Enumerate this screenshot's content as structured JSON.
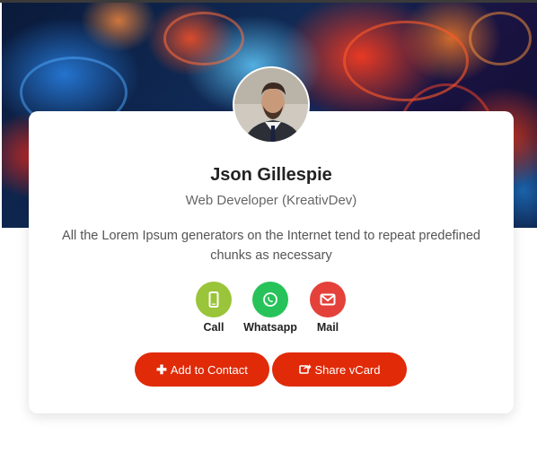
{
  "profile": {
    "name": "Json Gillespie",
    "title": "Web Developer (KreativDev)",
    "bio": "All the Lorem Ipsum generators on the Internet tend to repeat predefined chunks as necessary"
  },
  "actions": [
    {
      "label": "Call",
      "icon": "phone-icon",
      "color": "#9ac43a"
    },
    {
      "label": "Whatsapp",
      "icon": "whatsapp-icon",
      "color": "#27c35a"
    },
    {
      "label": "Mail",
      "icon": "mail-icon",
      "color": "#e4413b"
    }
  ],
  "buttons": {
    "add_contact": {
      "label": "Add to Contact",
      "icon": "plus-icon"
    },
    "share_vcard": {
      "label": "Share vCard",
      "icon": "share-icon"
    }
  },
  "colors": {
    "accent": "#e02a08",
    "card": "#ffffff"
  }
}
